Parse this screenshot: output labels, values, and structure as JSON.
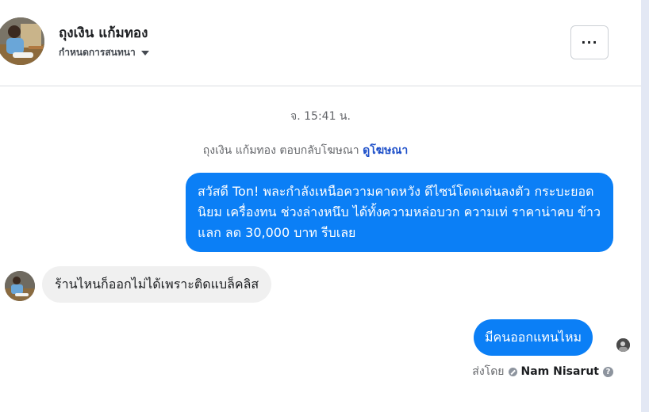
{
  "header": {
    "name": "ถุงเงิน แก้มทอง",
    "subtitle": "กำหนดการสนทนา",
    "more_label": "···"
  },
  "thread": {
    "timestamp": "จ. 15:41 น.",
    "ad_reply": {
      "text": "ถุงเงิน แก้มทอง ตอบกลับโฆษณา",
      "link": "ดูโฆษณา"
    },
    "messages": [
      {
        "direction": "outgoing",
        "text": "สวัสดี Ton! พละกำลังเหนือความคาดหวัง ดีไซน์โดดเด่นลงตัว กระบะยอดนิยม เครื่องทน ช่วงล่างหนึบ ได้ทั้งความหล่อบวก ความเท่ ราคาน่าคบ ข้าว แลก ลด 30,000 บาท รีบเลย"
      },
      {
        "direction": "incoming",
        "text": "ร้านไหนก็ออกไม่ได้เพราะติดแบล็คลิส"
      },
      {
        "direction": "outgoing",
        "text": "มีคนออกแทนไหม"
      }
    ],
    "sent_by": {
      "prefix": "ส่งโดย",
      "name": "Nam Nisarut",
      "help": "?"
    }
  },
  "colors": {
    "outgoing_bubble": "#0b7ff6",
    "incoming_bubble": "#f0f0f0",
    "link": "#1d4fc9"
  }
}
